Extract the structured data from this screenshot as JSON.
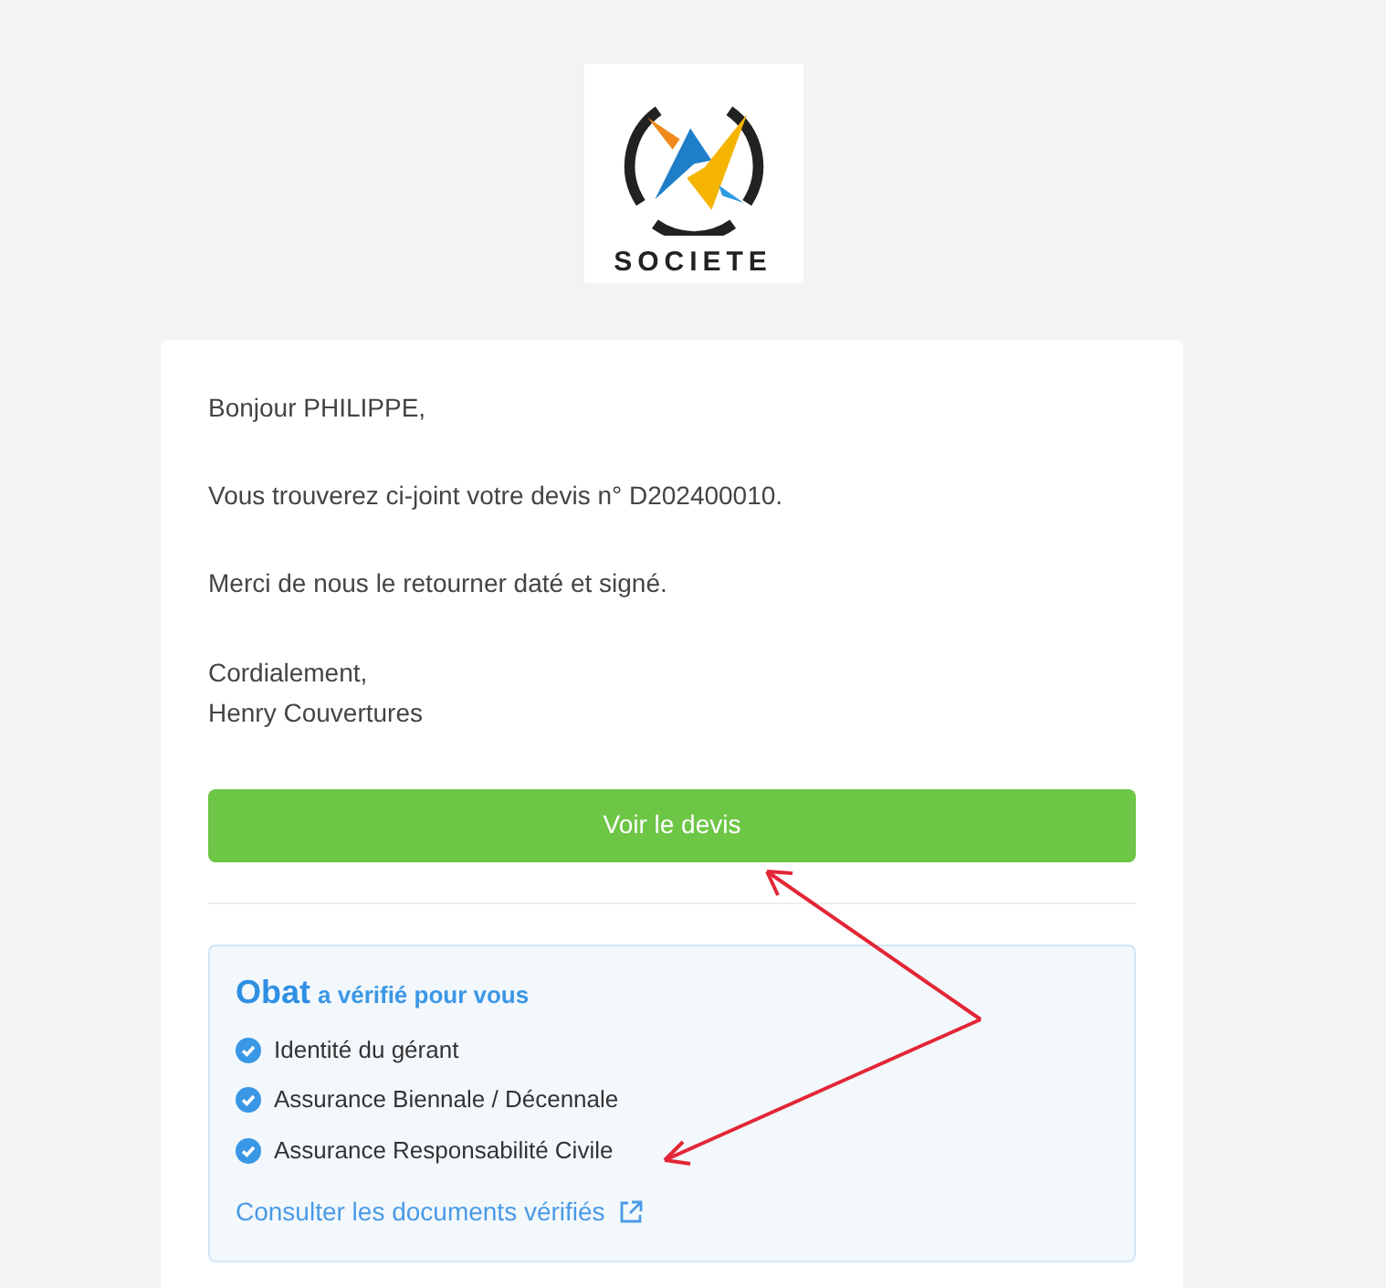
{
  "logo": {
    "name": "SOCIETE"
  },
  "message": {
    "greeting": "Bonjour PHILIPPE,",
    "paragraphs": [
      "Vous trouverez ci-joint votre devis n° D202400010.",
      "Merci de nous le retourner daté et signé."
    ],
    "closing": "Cordialement,",
    "signature": "Henry Couvertures"
  },
  "button": {
    "label": "Voir le devis"
  },
  "verification": {
    "brand": "Obat",
    "heading": "a vérifié pour vous",
    "items": [
      {
        "label": "Identité du gérant",
        "verified": true
      },
      {
        "label": "Assurance Biennale / Décennale",
        "verified": true
      },
      {
        "label": "Assurance Responsabilité Civile",
        "verified": true
      }
    ],
    "link": "Consulter les documents vérifiés"
  }
}
